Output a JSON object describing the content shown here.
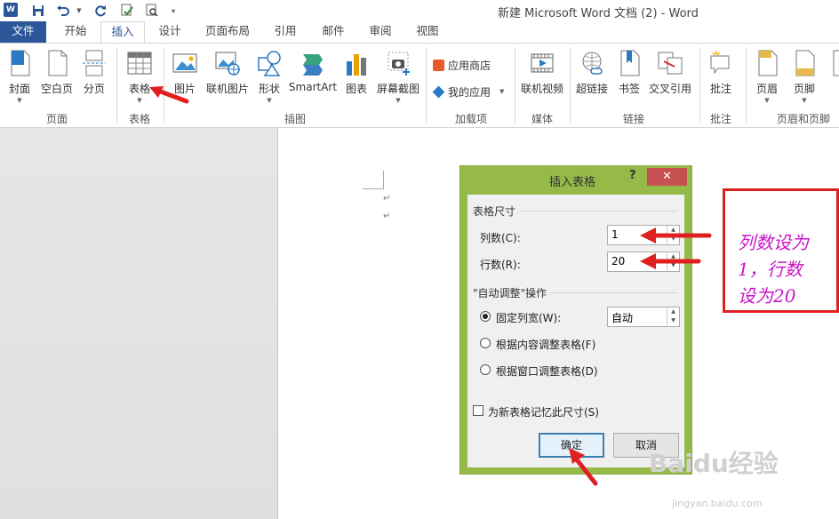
{
  "titlebar": {
    "logo": "W",
    "title": "新建 Microsoft Word 文档 (2) - Word"
  },
  "tabs": [
    "文件",
    "开始",
    "插入",
    "设计",
    "页面布局",
    "引用",
    "邮件",
    "审阅",
    "视图"
  ],
  "ribbon": {
    "page_group": {
      "cover": "封面",
      "blank": "空白页",
      "break": "分页",
      "label": "页面"
    },
    "table_group": {
      "table": "表格",
      "label": "表格"
    },
    "illus_group": {
      "picture": "图片",
      "online_picture": "联机图片",
      "shapes": "形状",
      "smartart": "SmartArt",
      "chart": "图表",
      "screenshot": "屏幕截图",
      "label": "插图"
    },
    "addins_group": {
      "store": "应用商店",
      "myapps": "我的应用",
      "label": "加载项"
    },
    "media_group": {
      "video": "联机视频",
      "label": "媒体"
    },
    "links_group": {
      "hyperlink": "超链接",
      "bookmark": "书签",
      "crossref": "交叉引用",
      "label": "链接"
    },
    "comment_group": {
      "comment": "批注",
      "label": "批注"
    },
    "hf_group": {
      "header": "页眉",
      "footer": "页脚",
      "label": "页眉和页脚"
    }
  },
  "page": {
    "return_mark": "↵"
  },
  "dialog": {
    "title": "插入表格",
    "help": "?",
    "close": "✕",
    "size_section": "表格尺寸",
    "cols_label": "列数(C):",
    "cols_value": "1",
    "rows_label": "行数(R):",
    "rows_value": "20",
    "autofit_section": "\"自动调整\"操作",
    "fixed_label": "固定列宽(W):",
    "fixed_value": "自动",
    "content_label": "根据内容调整表格(F)",
    "window_label": "根据窗口调整表格(D)",
    "remember_label": "为新表格记忆此尺寸(S)",
    "ok": "确定",
    "cancel": "取消"
  },
  "annotation": {
    "line1": "列数设为",
    "line2": "1，行数",
    "line3": "设为20"
  },
  "watermark": {
    "brand": "Baidu经验",
    "url": "jingyan.baidu.com"
  },
  "colors": {
    "accent": "#2b579a",
    "dialog_frame": "#96ba49",
    "arrow_red": "#e02020",
    "annot_text": "#c815c8"
  }
}
